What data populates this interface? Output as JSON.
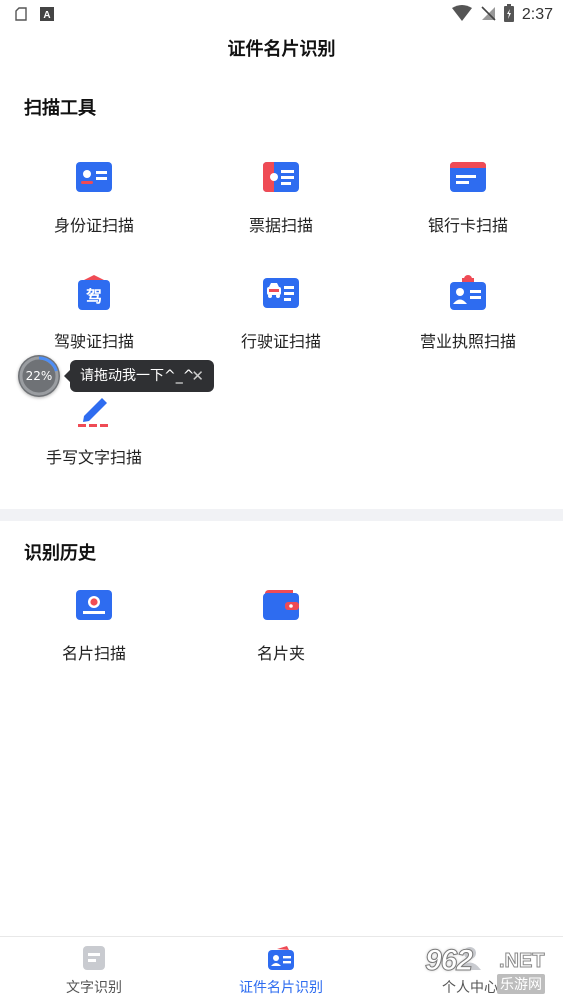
{
  "status_bar": {
    "time": "2:37"
  },
  "header": {
    "title": "证件名片识别"
  },
  "scan_tools": {
    "title": "扫描工具",
    "items": [
      {
        "label": "身份证扫描",
        "icon": "id-card-icon"
      },
      {
        "label": "票据扫描",
        "icon": "ticket-icon"
      },
      {
        "label": "银行卡扫描",
        "icon": "bank-card-icon"
      },
      {
        "label": "驾驶证扫描",
        "icon": "driver-license-icon"
      },
      {
        "label": "行驶证扫描",
        "icon": "vehicle-license-icon"
      },
      {
        "label": "营业执照扫描",
        "icon": "business-license-icon"
      },
      {
        "label": "手写文字扫描",
        "icon": "handwriting-icon"
      }
    ]
  },
  "history": {
    "title": "识别历史",
    "items": [
      {
        "label": "名片扫描",
        "icon": "business-card-icon"
      },
      {
        "label": "名片夹",
        "icon": "card-holder-icon"
      }
    ]
  },
  "floating": {
    "percent": "22%",
    "tooltip": "请拖动我一下^_^"
  },
  "tabs": [
    {
      "label": "文字识别",
      "active": false
    },
    {
      "label": "证件名片识别",
      "active": true
    },
    {
      "label": "个人中心",
      "active": false
    }
  ],
  "watermark": {
    "number": "962",
    "net": ".NET",
    "sub": "乐游网"
  },
  "colors": {
    "accent": "#2e6cf0",
    "red": "#ef4b55",
    "tooltip_bg": "#2f3033"
  }
}
